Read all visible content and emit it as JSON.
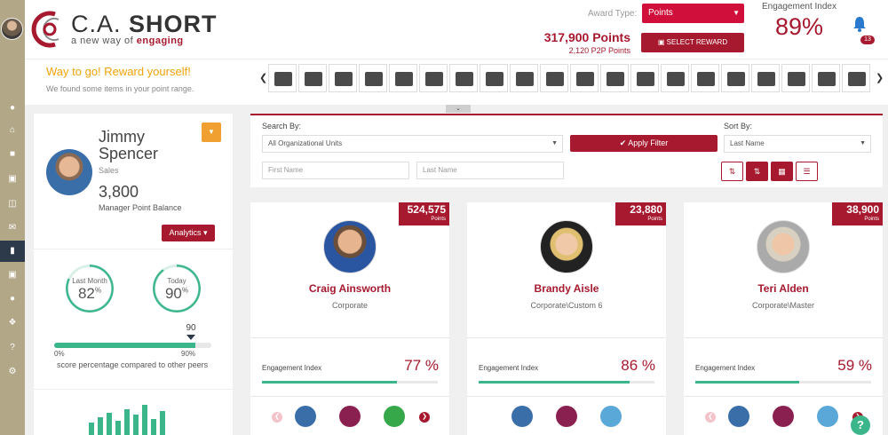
{
  "brand": {
    "name_light": "C.A.",
    "name_bold": "SHORT",
    "tagline_pre": "a new way of",
    "tagline_bold": "engaging",
    "colors": {
      "primary": "#a6192e",
      "accent": "#f0a030",
      "success": "#3bb58a",
      "rail": "#b2a888"
    }
  },
  "header": {
    "award_type_label": "Award Type:",
    "award_type_value": "Points",
    "points_total": "317,900 Points",
    "points_sub": "2,120 P2P Points",
    "select_reward_label": "SELECT REWARD",
    "engagement_label": "Engagement Index",
    "engagement_value": "89%",
    "notification_count": "13"
  },
  "rail": {
    "icons": [
      "user-icon",
      "home-icon",
      "chat-icon",
      "image-icon",
      "inbox-icon",
      "mail-icon",
      "bar-chart-icon",
      "gift-icon",
      "team-icon",
      "tools-icon",
      "help-icon",
      "settings-icon"
    ]
  },
  "reward_strip": {
    "title": "Way to go! Reward yourself!",
    "subtitle": "We found some items in your point range.",
    "items": [
      "grill",
      "car-seat",
      "grill",
      "tv",
      "drone",
      "guitar",
      "necklace",
      "tv",
      "tv",
      "grill",
      "grill",
      "fridge",
      "grill",
      "grill",
      "kayak",
      "tv",
      "rowing-machine",
      "guitar",
      "oven",
      "tent"
    ]
  },
  "profile": {
    "first_name": "Jimmy",
    "last_name": "Spencer",
    "role": "Sales",
    "balance": "3,800",
    "balance_label": "Manager Point Balance",
    "analytics_label": "Analytics",
    "last_month_label": "Last Month",
    "last_month_value": "82",
    "today_label": "Today",
    "today_value": "90",
    "percent_sign": "%",
    "peer_marker": "90",
    "peer_value": 90,
    "peer_min": "0%",
    "peer_max": "90%",
    "peer_caption": "score percentage compared to other peers",
    "mini_chart": [
      12,
      18,
      22,
      14,
      26,
      20,
      30,
      16,
      24
    ]
  },
  "search": {
    "search_by_label": "Search By:",
    "org_units_value": "All Organizational Units",
    "first_name_placeholder": "First Name",
    "last_name_placeholder": "Last Name",
    "apply_label": "Apply Filter",
    "sort_by_label": "Sort By:",
    "sort_value": "Last Name"
  },
  "employees": [
    {
      "name": "Craig Ainsworth",
      "dept": "Corporate",
      "points": "524,575",
      "points_unit": "Points",
      "engagement_label": "Engagement Index",
      "engagement": "77 %",
      "engagement_value": 77
    },
    {
      "name": "Brandy Aisle",
      "dept": "Corporate\\Custom 6",
      "points": "23,880",
      "points_unit": "Points",
      "engagement_label": "Engagement Index",
      "engagement": "86 %",
      "engagement_value": 86
    },
    {
      "name": "Teri Alden",
      "dept": "Corporate\\Master",
      "points": "38,900",
      "points_unit": "Points",
      "engagement_label": "Engagement Index",
      "engagement": "59 %",
      "engagement_value": 59
    }
  ],
  "help_label": "?"
}
